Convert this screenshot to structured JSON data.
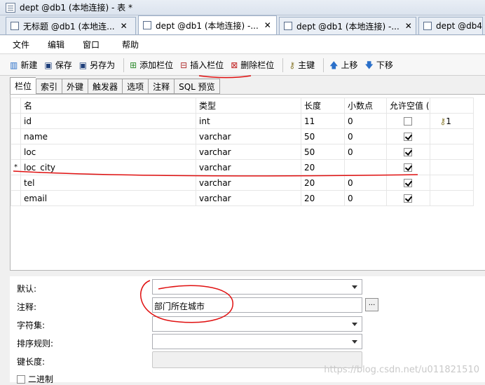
{
  "window": {
    "title": "dept @db1 (本地连接) - 表 *"
  },
  "tabs": [
    {
      "label": "无标题 @db1 (本地连..."
    },
    {
      "label": "dept @db1 (本地连接) -..."
    },
    {
      "label": "dept @db1 (本地连接) -..."
    },
    {
      "label": "dept @db4"
    }
  ],
  "menu": {
    "file": "文件",
    "edit": "编辑",
    "window": "窗口",
    "help": "帮助"
  },
  "toolbar": {
    "new": "新建",
    "save": "保存",
    "save_as": "另存为",
    "add_field": "添加栏位",
    "insert_field": "插入栏位",
    "delete_field": "删除栏位",
    "primary_key": "主键",
    "move_up": "上移",
    "move_down": "下移"
  },
  "subtabs": [
    "栏位",
    "索引",
    "外键",
    "触发器",
    "选项",
    "注释",
    "SQL 预览"
  ],
  "grid": {
    "headers": {
      "name": "名",
      "type": "类型",
      "length": "长度",
      "decimals": "小数点",
      "allow_null": "允许空值 ("
    },
    "current_marker": "*",
    "key_label": "1",
    "rows": [
      {
        "name": "id",
        "type": "int",
        "length": "11",
        "decimals": "0",
        "allow_null": false
      },
      {
        "name": "name",
        "type": "varchar",
        "length": "50",
        "decimals": "0",
        "allow_null": true
      },
      {
        "name": "loc",
        "type": "varchar",
        "length": "50",
        "decimals": "0",
        "allow_null": true
      },
      {
        "name": "loc_city",
        "type": "varchar",
        "length": "20",
        "decimals": "",
        "allow_null": true
      },
      {
        "name": "tel",
        "type": "varchar",
        "length": "20",
        "decimals": "0",
        "allow_null": true
      },
      {
        "name": "email",
        "type": "varchar",
        "length": "20",
        "decimals": "0",
        "allow_null": true
      }
    ]
  },
  "properties": {
    "default_label": "默认:",
    "comment_label": "注释:",
    "comment_value": "部门所在城市",
    "charset_label": "字符集:",
    "collation_label": "排序规则:",
    "key_length_label": "键长度:",
    "binary_label": "二进制",
    "ellipsis": "..."
  },
  "watermark": "https://blog.csdn.net/u011821510"
}
